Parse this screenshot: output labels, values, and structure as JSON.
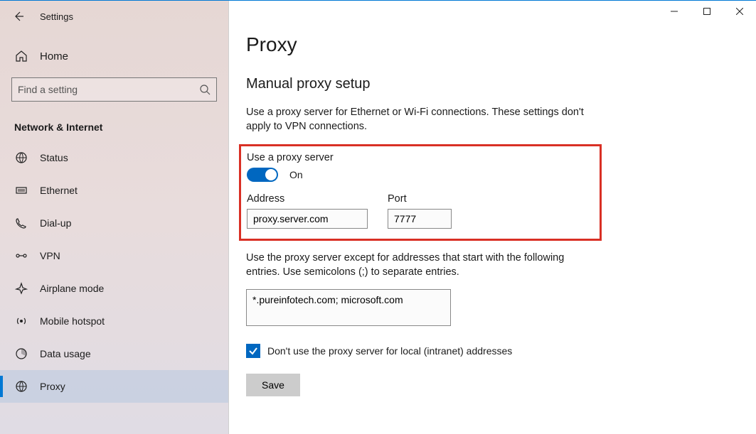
{
  "header": {
    "title": "Settings"
  },
  "sidebar": {
    "home": "Home",
    "search_placeholder": "Find a setting",
    "category": "Network & Internet",
    "items": [
      {
        "label": "Status"
      },
      {
        "label": "Ethernet"
      },
      {
        "label": "Dial-up"
      },
      {
        "label": "VPN"
      },
      {
        "label": "Airplane mode"
      },
      {
        "label": "Mobile hotspot"
      },
      {
        "label": "Data usage"
      },
      {
        "label": "Proxy"
      }
    ]
  },
  "main": {
    "title": "Proxy",
    "section_title": "Manual proxy setup",
    "description": "Use a proxy server for Ethernet or Wi-Fi connections. These settings don't apply to VPN connections.",
    "use_proxy_label": "Use a proxy server",
    "toggle_state": "On",
    "address_label": "Address",
    "address_value": "proxy.server.com",
    "port_label": "Port",
    "port_value": "7777",
    "exceptions_label": "Use the proxy server except for addresses that start with the following entries. Use semicolons (;) to separate entries.",
    "exceptions_value": "*.pureinfotech.com; microsoft.com",
    "local_checkbox_label": "Don't use the proxy server for local (intranet) addresses",
    "save": "Save"
  }
}
